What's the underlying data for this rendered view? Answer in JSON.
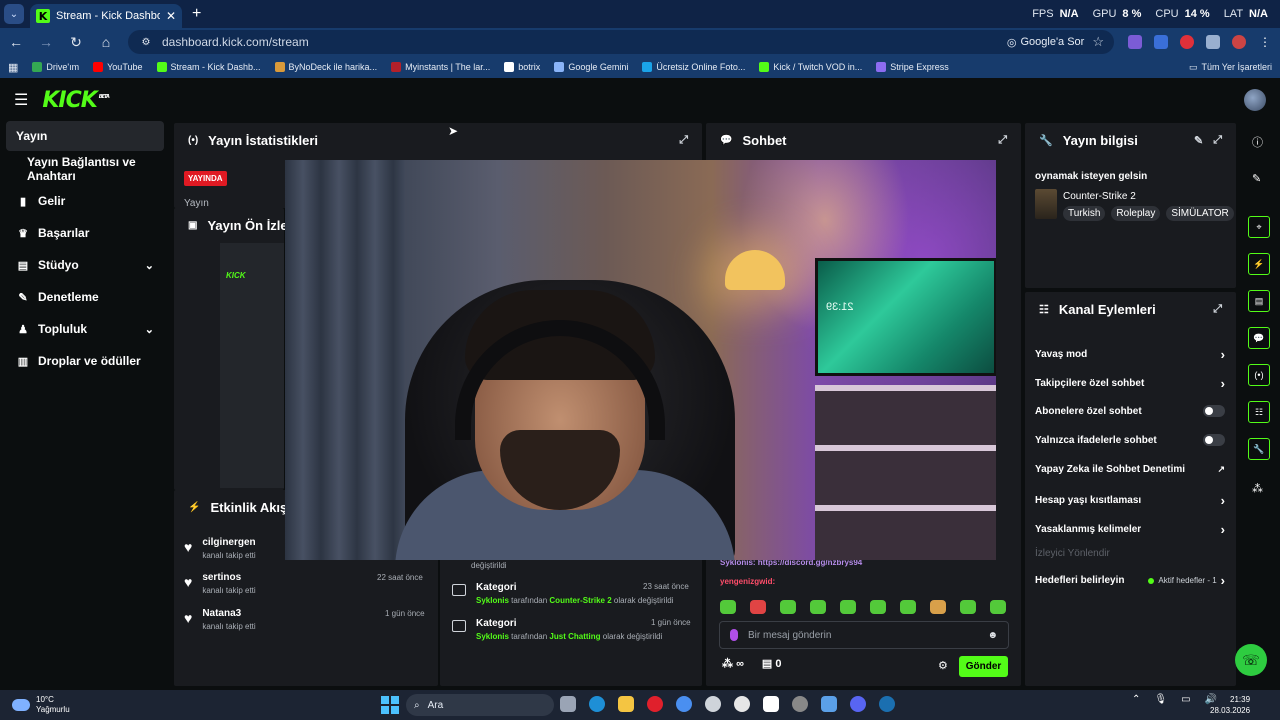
{
  "browser": {
    "tab_title": "Stream - Kick Dashboard",
    "tab_close": "✕",
    "new_tab": "+",
    "perf": [
      {
        "label": "FPS",
        "value": "N/A"
      },
      {
        "label": "GPU",
        "value": "8 %"
      },
      {
        "label": "CPU",
        "value": "14 %"
      },
      {
        "label": "LAT",
        "value": "N/A"
      }
    ],
    "url": "dashboard.kick.com/stream",
    "google_sor": "Google'a Sor",
    "bookmarks": [
      {
        "label": "Drive'ım",
        "color": "#34a853"
      },
      {
        "label": "YouTube",
        "color": "#ff0000"
      },
      {
        "label": "Stream - Kick Dashb...",
        "color": "#53fc18"
      },
      {
        "label": "ByNoDeck ile harika...",
        "color": "#d99a3a"
      },
      {
        "label": "Myinstants | The lar...",
        "color": "#b3202a"
      },
      {
        "label": "botrix",
        "color": "#ffffff"
      },
      {
        "label": "Google Gemini",
        "color": "#8ab4f8"
      },
      {
        "label": "Ücretsiz Online Foto...",
        "color": "#1aa3e8"
      },
      {
        "label": "Kick / Twitch VOD in...",
        "color": "#53fc18"
      },
      {
        "label": "Stripe Express",
        "color": "#8c6cf2"
      }
    ],
    "all_bookmarks": "Tüm Yer İşaretleri"
  },
  "kick": {
    "logo": "KICK",
    "beta": "BETA"
  },
  "sidebar": {
    "items": [
      {
        "label": "Yayın",
        "icon": "live-icon"
      },
      {
        "label": "Yayın Bağlantısı ve Anahtarı",
        "icon": ""
      },
      {
        "label": "Gelir",
        "icon": "chart-icon"
      },
      {
        "label": "Başarılar",
        "icon": "trophy-icon"
      },
      {
        "label": "Stüdyo",
        "icon": "studio-icon"
      },
      {
        "label": "Denetleme",
        "icon": "wrench-icon"
      },
      {
        "label": "Topluluk",
        "icon": "people-icon"
      },
      {
        "label": "Droplar ve ödüller",
        "icon": "gift-icon"
      }
    ]
  },
  "stats": {
    "title": "Yayın İstatistikleri",
    "live_badge": "YAYINDA",
    "label": "Yayın"
  },
  "preview": {
    "title": "Yayın Ön İzle"
  },
  "activity": {
    "title": "Etkinlik Akışı",
    "followers": [
      {
        "name": "cilginergen",
        "sub": "kanalı takip etti",
        "time": ""
      },
      {
        "name": "sertinos",
        "sub": "kanalı takip etti",
        "time": "22 saat önce"
      },
      {
        "name": "Natana3",
        "sub": "kanalı takip etti",
        "time": "1 gün önce"
      }
    ],
    "partial_text": "değiştirildi",
    "categories": [
      {
        "title": "Kategori",
        "user": "Syklonis",
        "mid": "tarafından",
        "cat": "Counter-Strike 2",
        "end": "olarak değiştirildi",
        "time": "23 saat önce"
      },
      {
        "title": "Kategori",
        "user": "Syklonis",
        "mid": "tarafından",
        "cat": "Just Chatting",
        "end": "olarak değiştirildi",
        "time": "1 gün önce"
      }
    ]
  },
  "chat": {
    "title": "Sohbet",
    "msg1": "Syklonis: https://discord.gg/nzbrys94",
    "msg2_user": "yengenizgwid:",
    "placeholder": "Bir mesaj gönderin",
    "infinity": "∞",
    "count": "0",
    "send": "Gönder"
  },
  "stream_info": {
    "title": "Yayın bilgisi",
    "stream_title": "oynamak isteyen gelsin",
    "game": "Counter-Strike 2",
    "tags": [
      "Turkish",
      "Roleplay",
      "SİMÜLATOR"
    ]
  },
  "channel_actions": {
    "title": "Kanal Eylemleri",
    "items": [
      {
        "label": "Yavaş mod",
        "control": "chevron"
      },
      {
        "label": "Takipçilere özel sohbet",
        "control": "chevron"
      },
      {
        "label": "Abonelere özel sohbet",
        "control": "toggle"
      },
      {
        "label": "Yalnızca ifadelerle sohbet",
        "control": "toggle"
      },
      {
        "label": "Yapay Zeka ile Sohbet Denetimi",
        "control": "external"
      },
      {
        "label": "Hesap yaşı kısıtlaması",
        "control": "chevron"
      },
      {
        "label": "Yasaklanmış kelimeler",
        "control": "chevron"
      },
      {
        "label": "İzleyici Yönlendir",
        "control": "none"
      },
      {
        "label": "Hedefleri belirleyin",
        "control": "chevron"
      }
    ],
    "active_goals": "Aktif hedefler - 1"
  },
  "video_overlay": {
    "tv_clock": "21:39"
  },
  "taskbar": {
    "temp": "10°C",
    "weather": "Yağmurlu",
    "search": "Ara",
    "time": "21:39",
    "date": "28.03.2026"
  }
}
